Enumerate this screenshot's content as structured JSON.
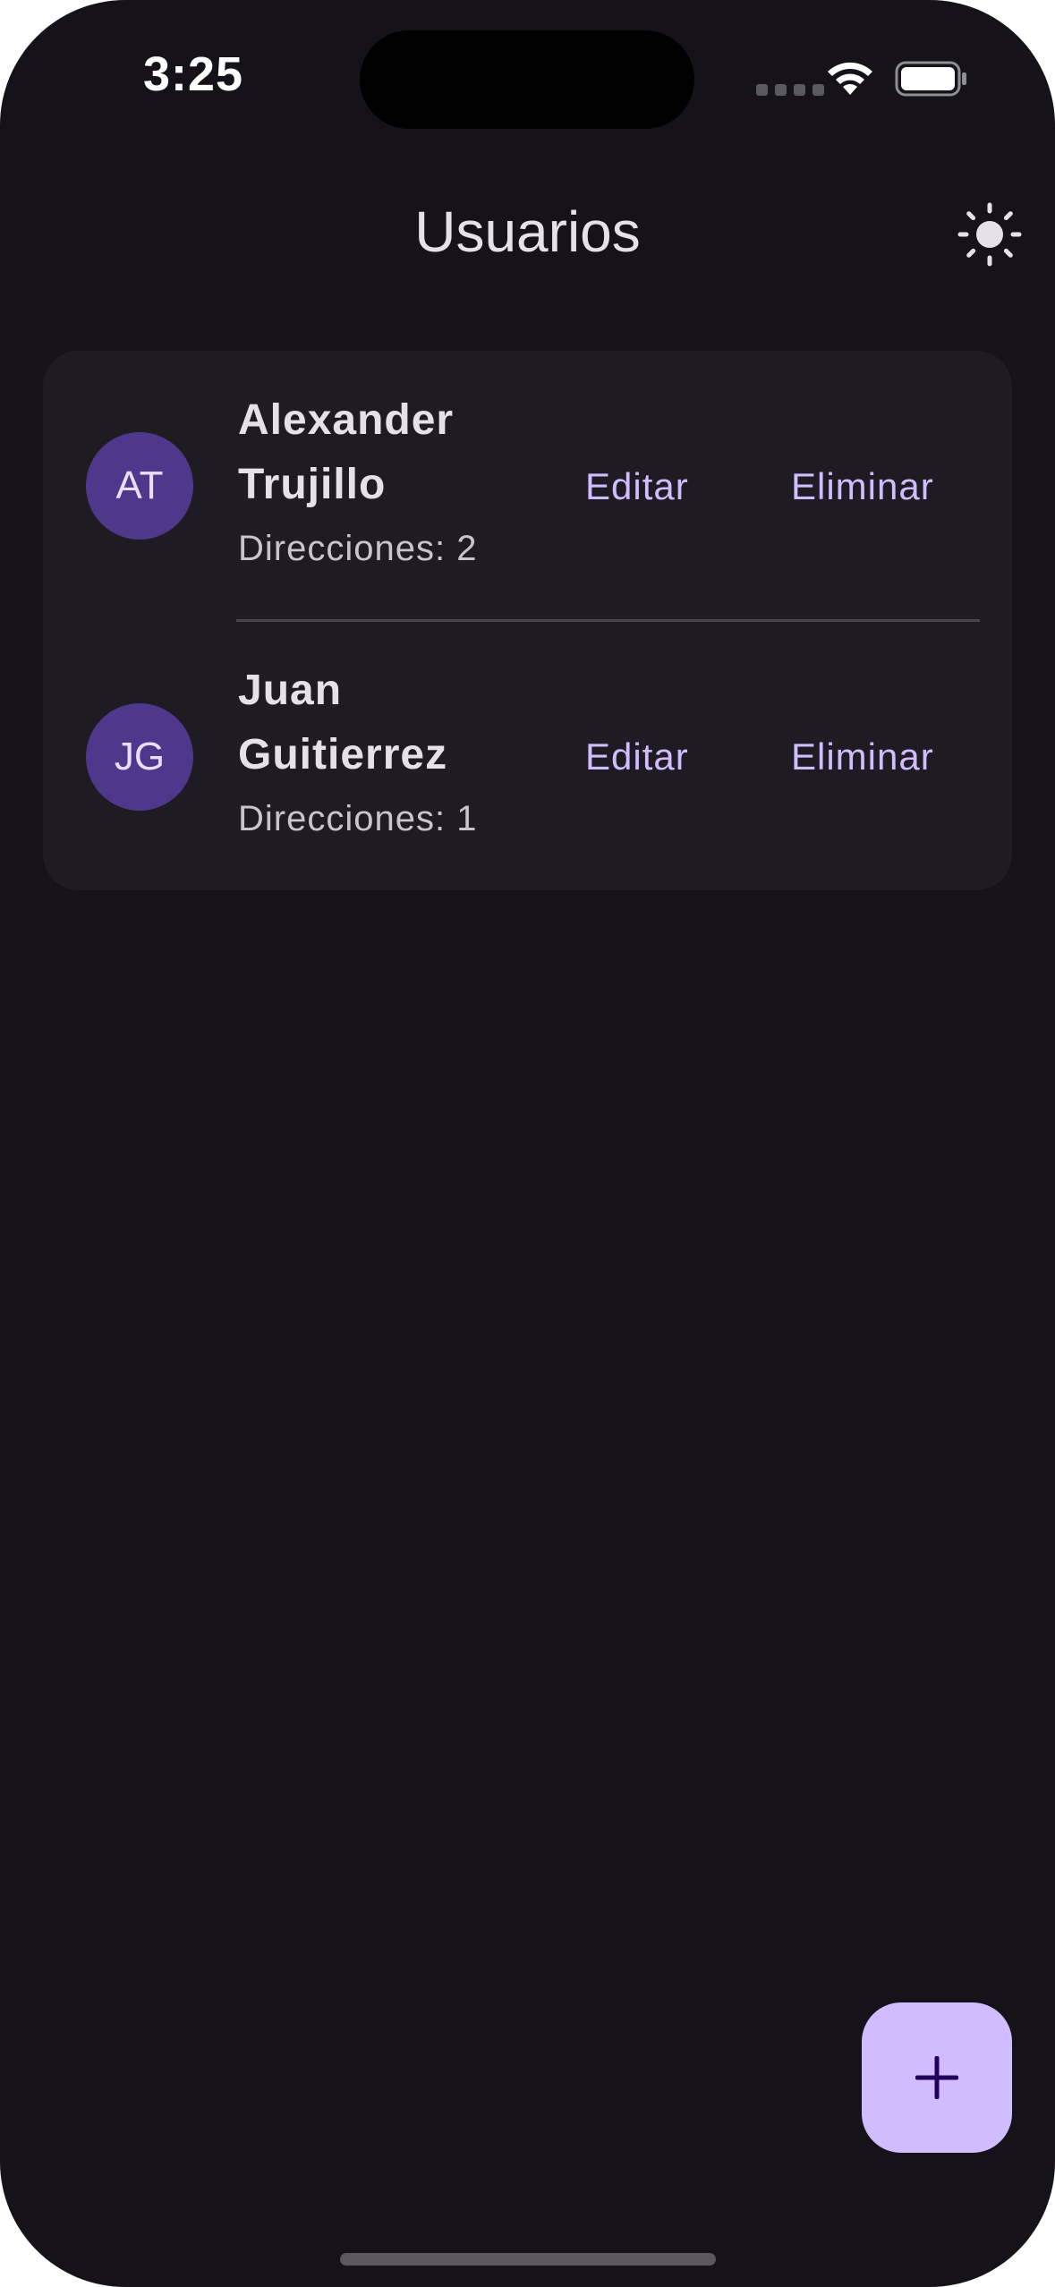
{
  "status_bar": {
    "time": "3:25"
  },
  "app_bar": {
    "title": "Usuarios",
    "theme_icon": "sun-icon"
  },
  "users": [
    {
      "initials": "AT",
      "name": "Alexander Trujillo",
      "addresses": "Direcciones: 2",
      "edit_label": "Editar",
      "delete_label": "Eliminar"
    },
    {
      "initials": "JG",
      "name": "Juan Guitierrez",
      "addresses": "Direcciones: 1",
      "edit_label": "Editar",
      "delete_label": "Eliminar"
    }
  ],
  "fab": {
    "icon": "plus-icon"
  },
  "colors": {
    "background": "#151219",
    "card": "#1e1c22",
    "avatar": "#4f378b",
    "accent": "#d0bcff"
  }
}
